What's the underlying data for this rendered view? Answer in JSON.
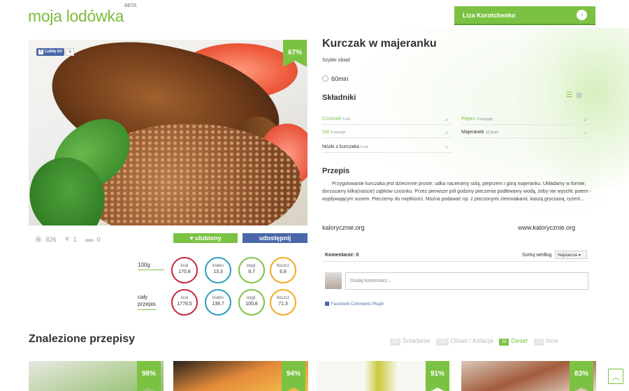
{
  "header": {
    "logo": "moja lodówka",
    "beta": "BETA",
    "user_name": "Liza Korotchenko",
    "user_arrow": "›"
  },
  "photo": {
    "fb_like": "Lubię to!",
    "fb_count": "0",
    "match": "67%"
  },
  "stats": {
    "views": "826",
    "likes": "1",
    "comments": "0",
    "fav_button": "♥ ulubiony",
    "share_button": "udostępnij"
  },
  "nutrition": {
    "row1_label": "100g",
    "row2_label": "cały przepis",
    "labels": [
      "kcal",
      "białko",
      "węgl.",
      "tłuszcz"
    ],
    "row1": [
      "170,8",
      "13,3",
      "9,7",
      "6,8"
    ],
    "row2": [
      "1778,5",
      "138,7",
      "100,8",
      "71,3"
    ],
    "colors": [
      "#c5253a",
      "#2b9bbd",
      "#7cc242",
      "#f1a91e"
    ]
  },
  "recipe": {
    "title": "Kurczak w majeranku",
    "subtitle": "Szybki obiad",
    "time": "60min",
    "ingredients_title": "Składniki",
    "ingredients": [
      {
        "name": "Czosnek",
        "amount": "5 szt.",
        "have": true
      },
      {
        "name": "Pieprz",
        "amount": "3 szczypty",
        "have": true
      },
      {
        "name": "Sól",
        "amount": "5 szczypt",
        "have": true
      },
      {
        "name": "Majeranek",
        "amount": "10 łyżek",
        "have": false
      },
      {
        "name": "Nóżki z kurczaka",
        "amount": "6 szt.",
        "have": false
      }
    ],
    "method_title": "Przepis",
    "method_text": "Przygotowanie kurczaka jest dziecinnie proste: udka nacieramy solą, pieprzem i górą majeranku. Układamy w formie, dorzucamy kilka(naście) ząbków czosnku. Przez pierwsze pół godziny pieczenia podlewamy wodą, żeby nie wyschł; potem - wypływającym sosem. Pieczemy do miękkości. Można podawać np. z pieczonymi ziemniakami, kaszą gryczaną, ryżem...",
    "source_left": "kalorycznie.org",
    "source_right": "www.kalorycznie.org"
  },
  "comments": {
    "count_label": "Komentarze: 0",
    "sort_label": "Sortuj według",
    "sort_value": "Najstarsze ▾",
    "placeholder": "Dodaj komentarz...",
    "plugin": "Facebook Comments Plugin"
  },
  "found": {
    "title": "Znalezione przepisy",
    "filters": [
      {
        "count": "59",
        "label": "Śniadanie",
        "active": false
      },
      {
        "count": "144",
        "label": "Obiad / Kolacja",
        "active": false
      },
      {
        "count": "39",
        "label": "Deser",
        "active": true
      },
      {
        "count": "37",
        "label": "Inne",
        "active": false
      }
    ],
    "cards": [
      {
        "match": "98%"
      },
      {
        "match": "94%"
      },
      {
        "match": "91%"
      },
      {
        "match": "83%"
      }
    ]
  },
  "scroll_top": "︿"
}
